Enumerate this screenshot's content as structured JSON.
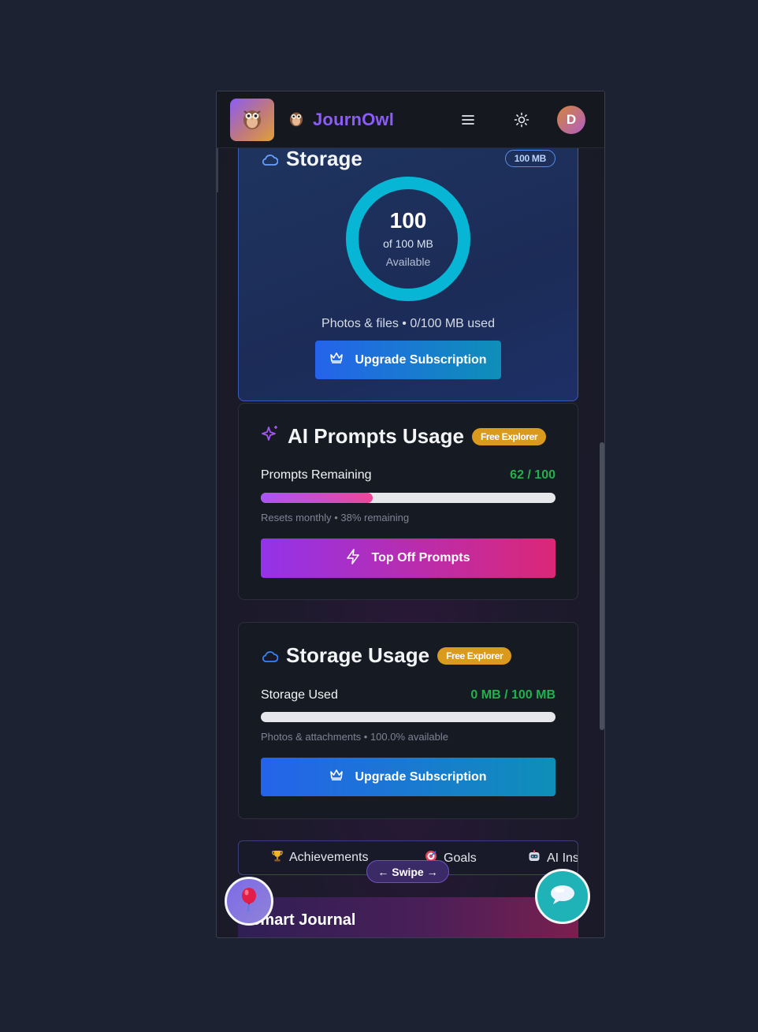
{
  "header": {
    "brand_name": "JournOwl",
    "avatar_initial": "D",
    "menu_icon": "menu-icon",
    "theme_icon": "sun-icon"
  },
  "storage_card": {
    "title": "Storage",
    "badge": "100 MB",
    "ring_value": "100",
    "ring_of": "of 100 MB",
    "ring_label": "Available",
    "ring_fraction_available": 1.0,
    "usage_line": "Photos & files • 0/100 MB used",
    "button_label": "Upgrade Subscription"
  },
  "ai_prompts_card": {
    "title": "AI Prompts Usage",
    "badge": "Free Explorer",
    "row_label": "Prompts Remaining",
    "row_value": "62 / 100",
    "progress_fraction": 0.38,
    "note": "Resets monthly • 38% remaining",
    "button_label": "Top Off Prompts"
  },
  "storage_usage_card": {
    "title": "Storage Usage",
    "badge": "Free Explorer",
    "row_label": "Storage Used",
    "row_value": "0 MB / 100 MB",
    "progress_fraction": 0.0,
    "note": "Photos & attachments • 100.0% available",
    "button_label": "Upgrade Subscription"
  },
  "tabs": [
    {
      "label": "Achievements",
      "icon": "trophy-icon"
    },
    {
      "label": "Goals",
      "icon": "target-icon"
    },
    {
      "label": "AI Ins",
      "icon": "robot-icon"
    }
  ],
  "swipe_hint": "← Swipe →",
  "journal": {
    "title": "Smart Journal"
  },
  "colors": {
    "brand": "#8b5cf6",
    "accent_green": "#22b14c",
    "ring": "#06b6d4",
    "badge_gold": "#d99a1e"
  }
}
